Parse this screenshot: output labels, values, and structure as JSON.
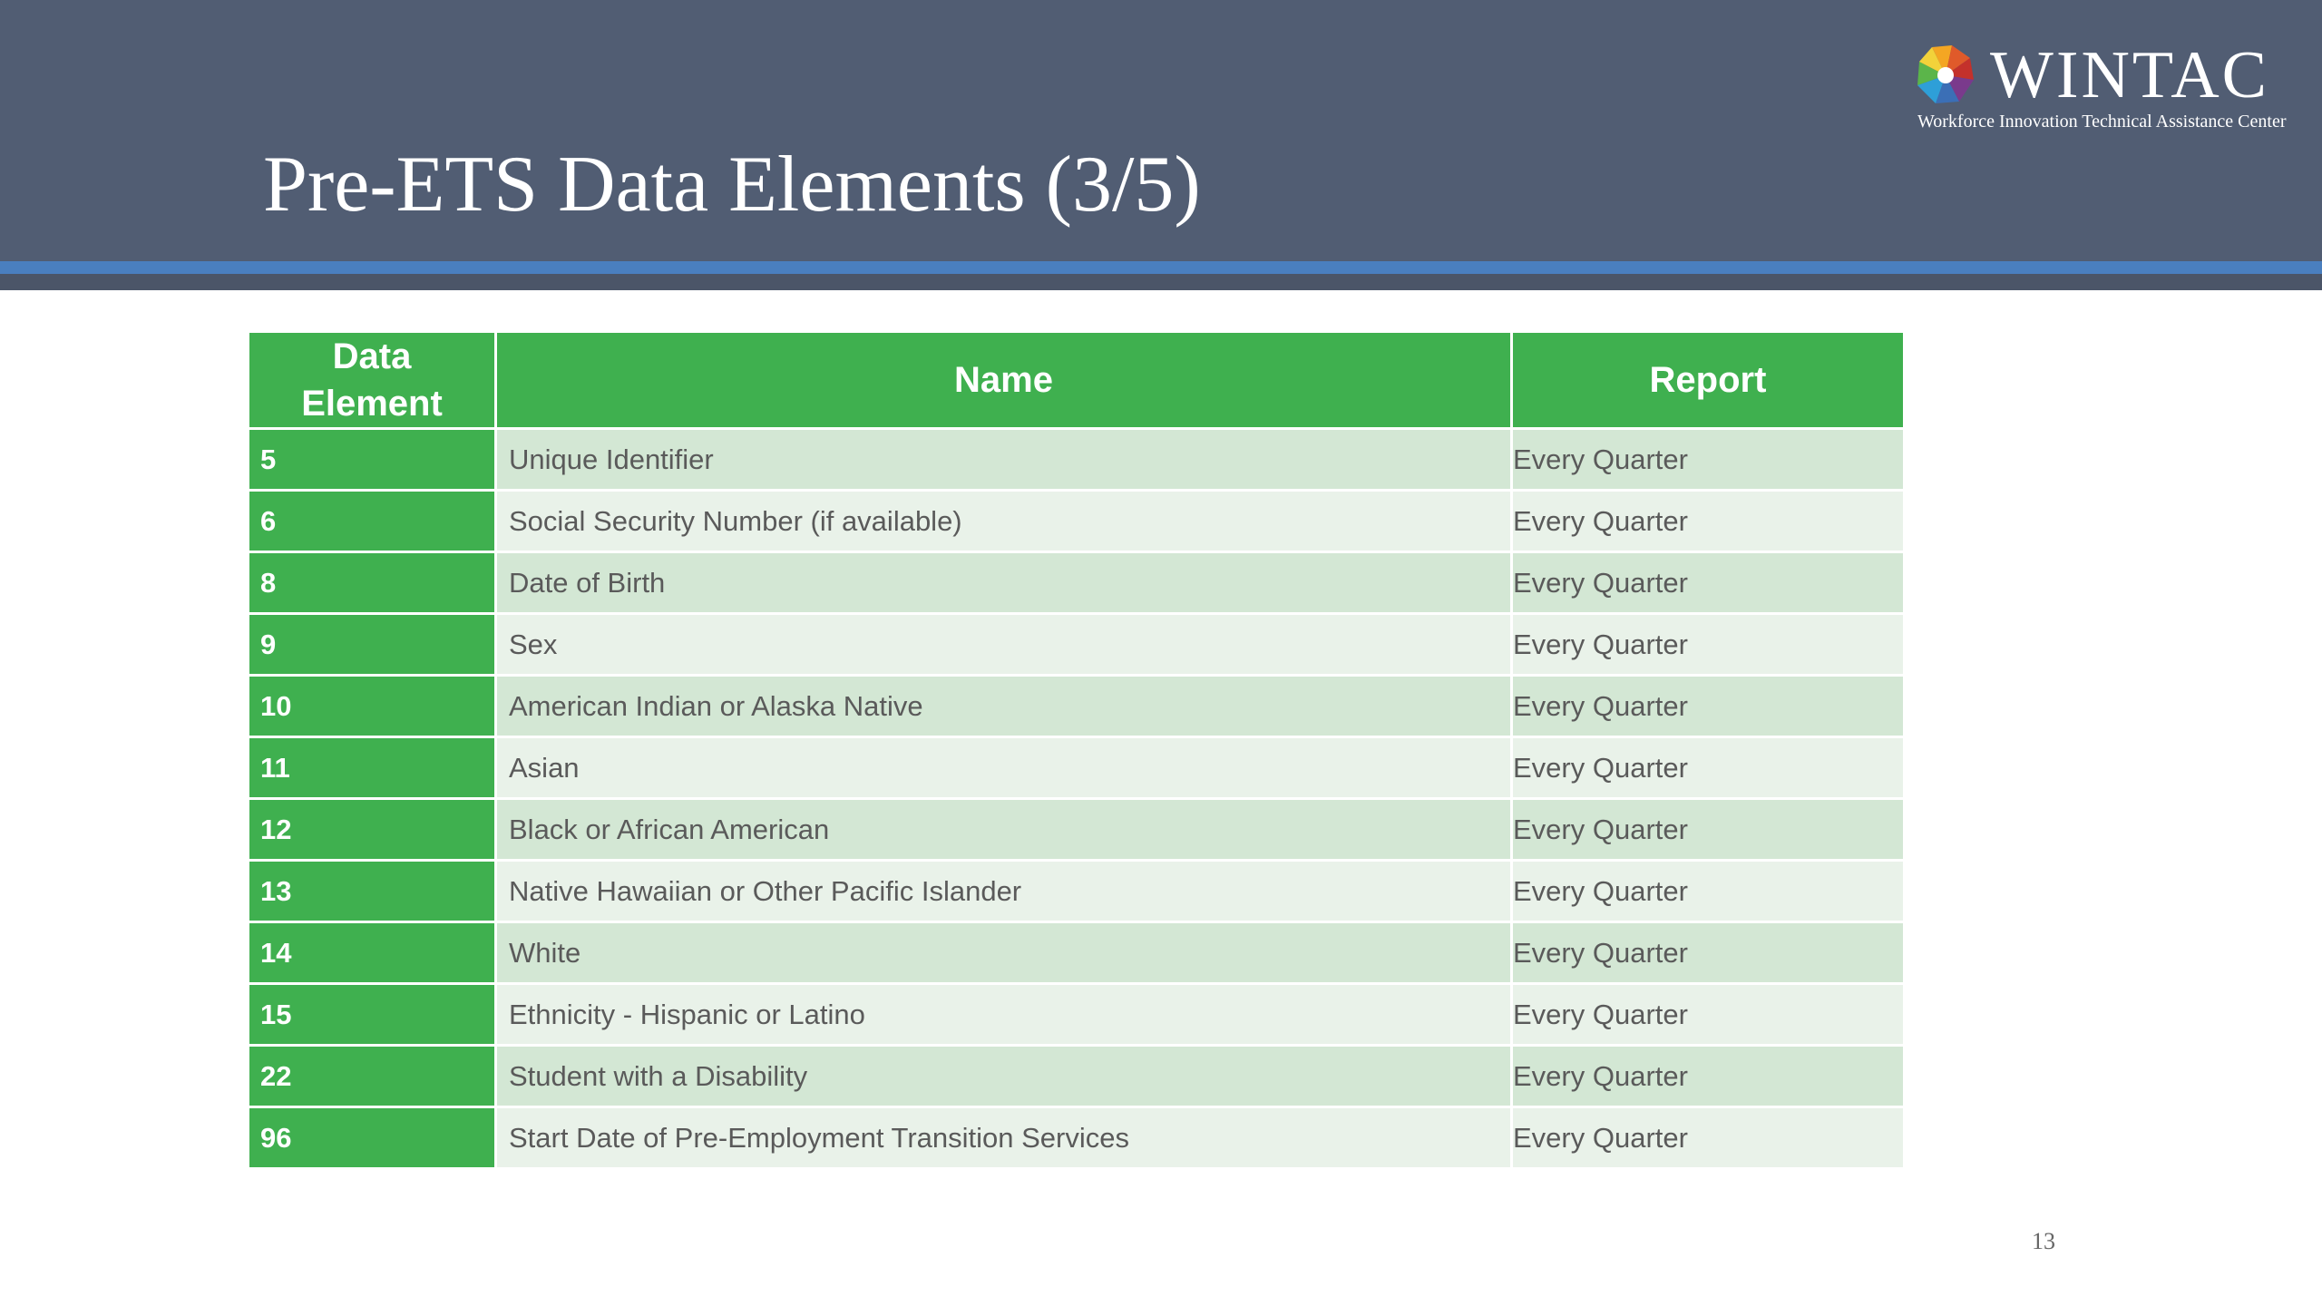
{
  "slide": {
    "title": "Pre-ETS Data Elements (3/5)",
    "page_number": "13"
  },
  "logo": {
    "name": "WINTAC",
    "tagline": "Workforce Innovation Technical Assistance Center",
    "icon": "pinwheel-logo-icon"
  },
  "table": {
    "headers": {
      "element_line1": "Data",
      "element_line2": "Element",
      "name": "Name",
      "report": "Report"
    },
    "rows": [
      {
        "element": "5",
        "name": "Unique Identifier",
        "report": "Every Quarter"
      },
      {
        "element": "6",
        "name": "Social Security Number (if available)",
        "report": "Every Quarter"
      },
      {
        "element": "8",
        "name": "Date of Birth",
        "report": "Every Quarter"
      },
      {
        "element": "9",
        "name": "Sex",
        "report": "Every Quarter"
      },
      {
        "element": "10",
        "name": "American Indian or Alaska Native",
        "report": "Every Quarter"
      },
      {
        "element": "11",
        "name": "Asian",
        "report": "Every Quarter"
      },
      {
        "element": "12",
        "name": "Black or African American",
        "report": "Every Quarter"
      },
      {
        "element": "13",
        "name": "Native Hawaiian or Other Pacific Islander",
        "report": "Every Quarter"
      },
      {
        "element": "14",
        "name": "White",
        "report": "Every Quarter"
      },
      {
        "element": "15",
        "name": "Ethnicity - Hispanic or Latino",
        "report": "Every Quarter"
      },
      {
        "element": "22",
        "name": "Student with a Disability",
        "report": "Every Quarter"
      },
      {
        "element": "96",
        "name": "Start Date of Pre-Employment Transition Services",
        "report": "Every Quarter"
      }
    ]
  },
  "colors": {
    "header_bg": "#515d73",
    "accent_line": "#4a7fbf",
    "table_green": "#3fb04f",
    "row_odd": "#d3e7d4",
    "row_even": "#e9f2e9"
  }
}
